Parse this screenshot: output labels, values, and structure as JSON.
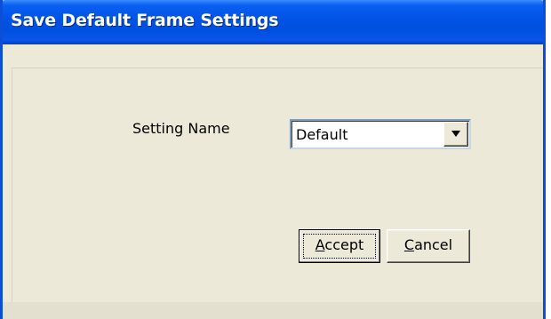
{
  "window": {
    "title": "Save Default Frame Settings"
  },
  "form": {
    "setting_label": "Setting Name",
    "setting_value": "Default"
  },
  "buttons": {
    "accept_mnemonic": "A",
    "accept_rest": "ccept",
    "cancel_mnemonic": "C",
    "cancel_rest": "ancel"
  },
  "icons": {
    "dropdown": "chevron-down-icon"
  },
  "colors": {
    "titlebar": "#0052e4",
    "window_frame": "#0a4fd6",
    "dialog_background": "#ece9d8"
  }
}
